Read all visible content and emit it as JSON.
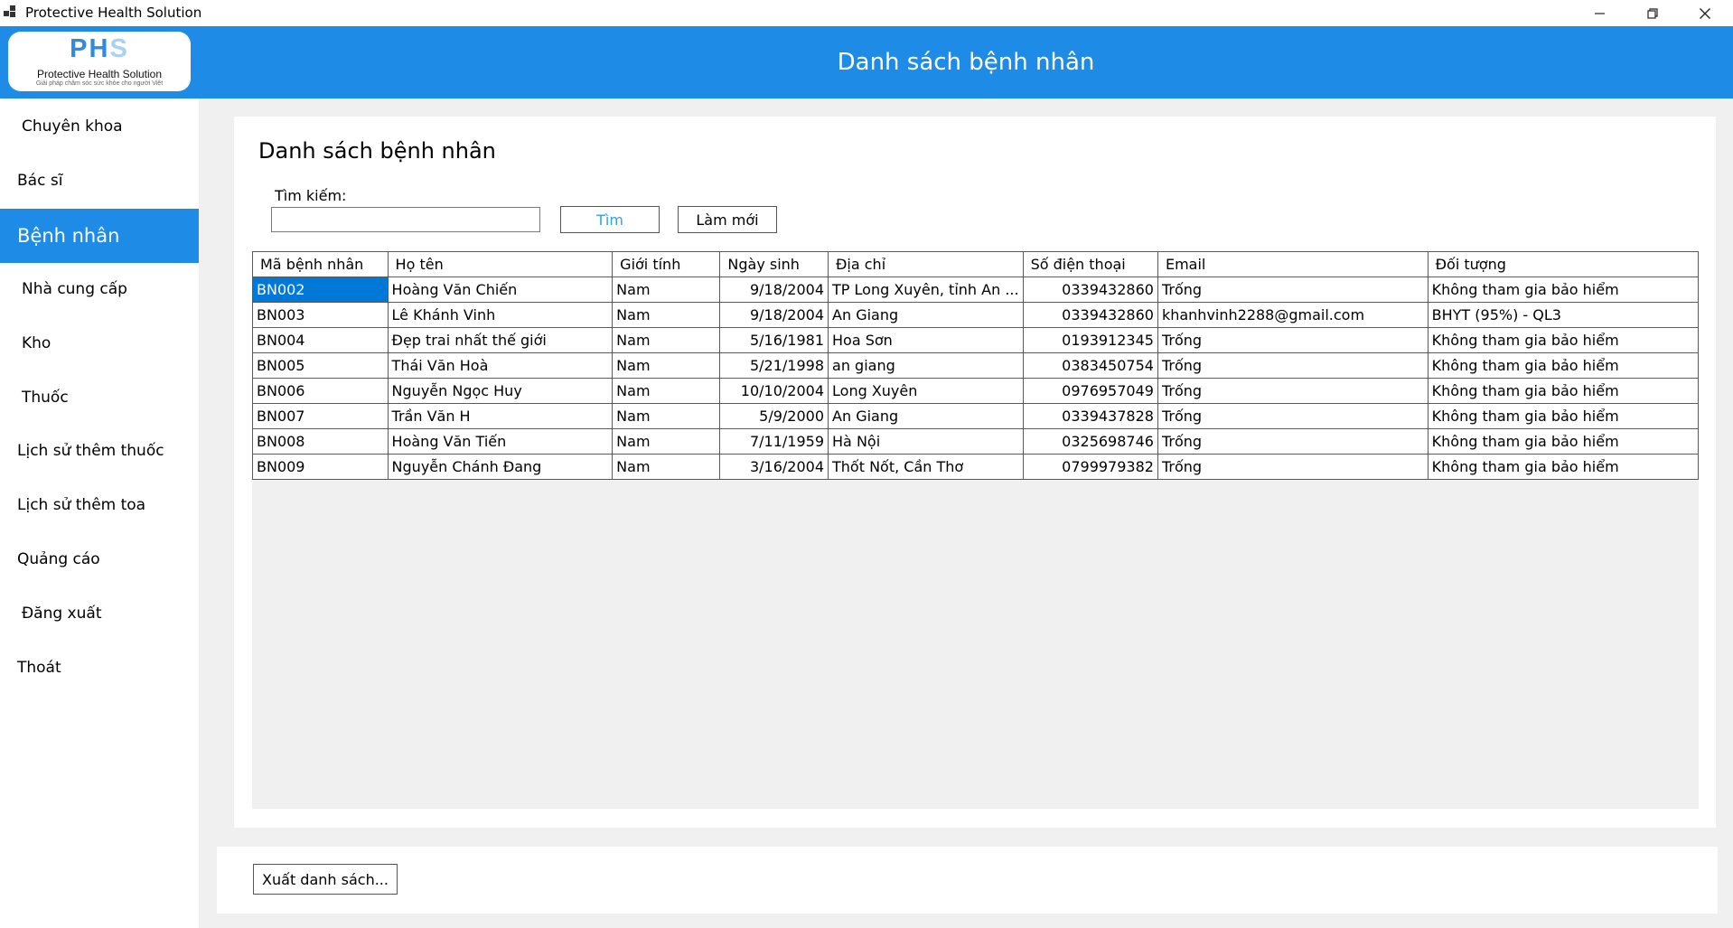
{
  "window": {
    "title": "Protective Health Solution"
  },
  "logo": {
    "letters_main": "PH",
    "letters_accent": "S",
    "name": "Protective Health Solution",
    "tagline": "Giải pháp chăm sóc sức khỏe cho người Việt"
  },
  "sidebar": {
    "items": [
      {
        "label": "Chuyên khoa"
      },
      {
        "label": "Bác sĩ"
      },
      {
        "label": "Bệnh nhân"
      },
      {
        "label": "Nhà cung cấp"
      },
      {
        "label": "Kho"
      },
      {
        "label": "Thuốc"
      },
      {
        "label": "Lịch sử thêm thuốc"
      },
      {
        "label": "Lịch sử thêm toa"
      },
      {
        "label": "Quảng cáo"
      },
      {
        "label": "Đăng xuất"
      },
      {
        "label": "Thoát"
      }
    ],
    "active_index": 2
  },
  "header": {
    "title": "Danh sách bệnh nhân"
  },
  "main": {
    "title": "Danh sách bệnh nhân",
    "search": {
      "label": "Tìm kiếm:",
      "value": "",
      "placeholder": ""
    },
    "find_button": "Tìm",
    "refresh_button": "Làm mới",
    "export_button": "Xuất danh sách..."
  },
  "table": {
    "columns": [
      "Mã bệnh nhân",
      "Họ tên",
      "Giới tính",
      "Ngày sinh",
      "Địa chỉ",
      "Số điện thoại",
      "Email",
      "Đối tượng"
    ],
    "rows": [
      [
        "BN002",
        "Hoàng Văn Chiến",
        "Nam",
        "9/18/2004",
        "TP Long Xuyên, tỉnh An ...",
        "0339432860",
        "Trống",
        "Không tham gia bảo hiểm"
      ],
      [
        "BN003",
        "Lê Khánh Vinh",
        "Nam",
        "9/18/2004",
        "An Giang",
        "0339432860",
        "khanhvinh2288@gmail.com",
        "BHYT (95%) - QL3"
      ],
      [
        "BN004",
        "Đẹp trai nhất thế giới",
        "Nam",
        "5/16/1981",
        "Hoa Sơn",
        "0193912345",
        "Trống",
        "Không tham gia bảo hiểm"
      ],
      [
        "BN005",
        "Thái Văn Hoà",
        "Nam",
        "5/21/1998",
        "an giang",
        "0383450754",
        "Trống",
        "Không tham gia bảo hiểm"
      ],
      [
        "BN006",
        "Nguyễn Ngọc Huy",
        "Nam",
        "10/10/2004",
        "Long Xuyên",
        "0976957049",
        "Trống",
        "Không tham gia bảo hiểm"
      ],
      [
        "BN007",
        "Trần Văn H",
        "Nam",
        "5/9/2000",
        "An Giang",
        "0339437828",
        "Trống",
        "Không tham gia bảo hiểm"
      ],
      [
        "BN008",
        "Hoàng Văn Tiến",
        "Nam",
        "7/11/1959",
        "Hà Nội",
        "0325698746",
        "Trống",
        "Không tham gia bảo hiểm"
      ],
      [
        "BN009",
        "Nguyễn Chánh Đang",
        "Nam",
        "3/16/2004",
        "Thốt Nốt, Cần Thơ",
        "0799979382",
        "Trống",
        "Không tham gia bảo hiểm"
      ]
    ],
    "selected_row": 0
  },
  "colors": {
    "accent": "#1e8ce6",
    "selection": "#0078d7",
    "find_text": "#35a3d9"
  }
}
